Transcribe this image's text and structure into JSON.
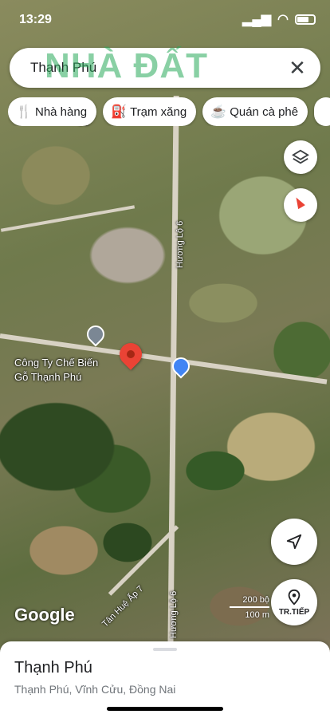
{
  "status_bar": {
    "time": "13:29"
  },
  "search": {
    "query": "Thạnh Phú"
  },
  "watermark": {
    "text": "NHÀ ĐẤT"
  },
  "chips": [
    {
      "icon": "🍴",
      "label": "Nhà hàng"
    },
    {
      "icon": "⛽",
      "label": "Trạm xăng"
    },
    {
      "icon": "☕",
      "label": "Quán cà phê"
    }
  ],
  "map": {
    "road_labels": [
      "Hương Lộ 6",
      "Hương Lộ 6",
      "Tân Huệ Ấp 7"
    ],
    "poi_line1": "Công Ty Chế Biến",
    "poi_line2": "Gỗ Thạnh Phú",
    "poi_top_fragment": "od",
    "attribution": "Google",
    "scale_top": "200 bộ",
    "scale_bottom": "100 m"
  },
  "controls": {
    "navigate_label": "TR.TIẾP"
  },
  "place_sheet": {
    "title": "Thạnh Phú",
    "address": "Thạnh Phú, Vĩnh Cửu, Đồng Nai"
  }
}
